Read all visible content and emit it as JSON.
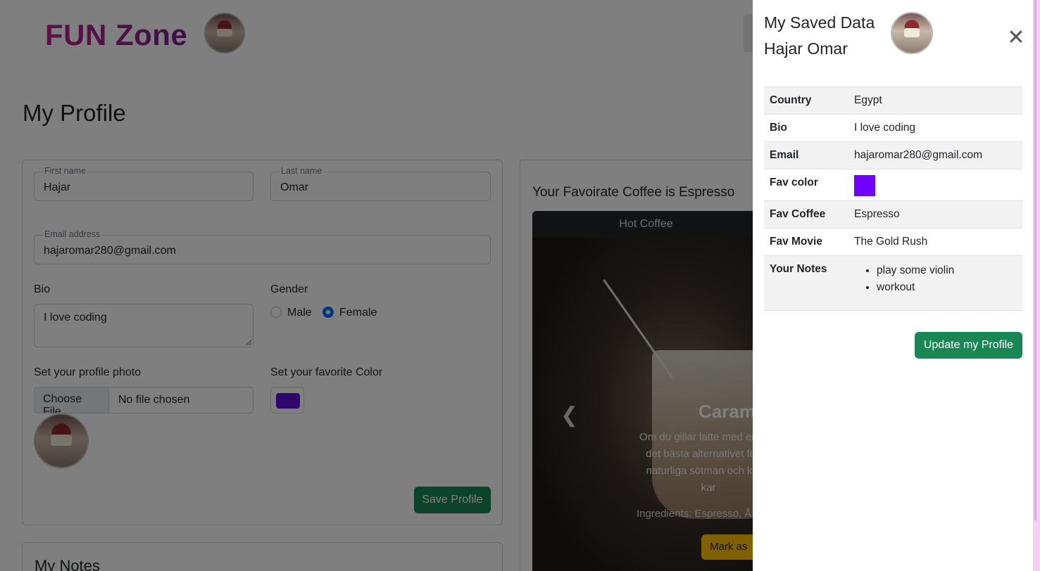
{
  "header": {
    "brand": "FUN Zone"
  },
  "profile": {
    "title": "My Profile",
    "first_name": {
      "label": "First name",
      "value": "Hajar"
    },
    "last_name": {
      "label": "Last name",
      "value": "Omar"
    },
    "email": {
      "label": "Email address",
      "value": "hajaromar280@gmail.com"
    },
    "bio": {
      "label": "Bio",
      "value": "I love coding"
    },
    "gender": {
      "label": "Gender",
      "options": [
        "Male",
        "Female"
      ],
      "selected": "Female"
    },
    "photo": {
      "label": "Set your profile photo",
      "button": "Choose File",
      "status": "No file chosen"
    },
    "color": {
      "label": "Set your favorite Color",
      "value": "#5a0fd6"
    },
    "save_label": "Save Profile"
  },
  "notes": {
    "title": "My Notes"
  },
  "coffee": {
    "heading": "Your Favoirate Coffee is Espresso",
    "tab": "Hot Coffee",
    "slide_title": "Caram",
    "slide_text": [
      "Om du gillar latte med en spe",
      "det bästa alternativet för at",
      "naturliga sötman och kräm",
      "kar"
    ],
    "ingredients": "Ingredients: Espresso, Å",
    "mark_label": "Mark as"
  },
  "panel": {
    "title": "My Saved Data",
    "name": "Hajar Omar",
    "rows": [
      {
        "key": "Country",
        "value": "Egypt"
      },
      {
        "key": "Bio",
        "value": "I love coding"
      },
      {
        "key": "Email",
        "value": "hajaromar280@gmail.com"
      },
      {
        "key": "Fav color",
        "value": "#7000ff"
      },
      {
        "key": "Fav Coffee",
        "value": "Espresso"
      },
      {
        "key": "Fav Movie",
        "value": "The Gold Rush"
      },
      {
        "key": "Your Notes",
        "items": [
          "play some violin",
          "workout"
        ]
      }
    ],
    "update_label": "Update my Profile",
    "close_icon": "close-icon"
  },
  "colors": {
    "brand_gradient": [
      "#c2238f",
      "#7a1f8a"
    ],
    "primary_green": "#198754",
    "radio_blue": "#0d6efd"
  }
}
